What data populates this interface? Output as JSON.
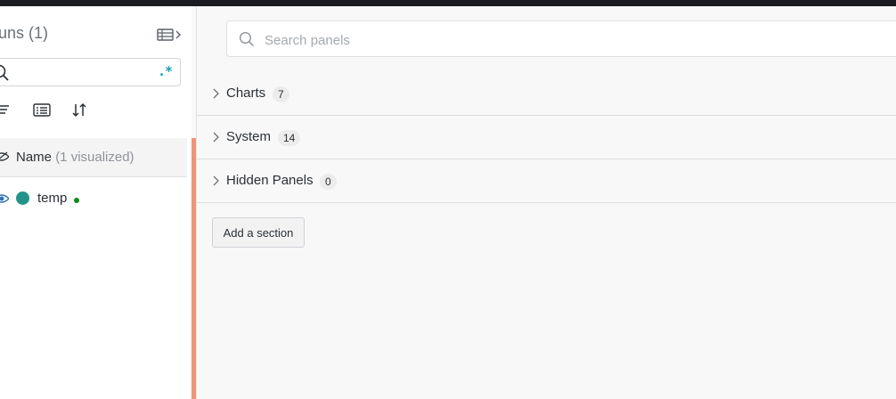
{
  "runs_panel": {
    "title": "uns (1)",
    "search": {
      "value": "",
      "placeholder": ""
    },
    "regex_label": ".*",
    "header": {
      "name_label": "Name",
      "visualized_label": "(1 visualized)"
    },
    "rows": [
      {
        "name": "temp",
        "color": "#229487",
        "status_color": "#0b8a17"
      }
    ],
    "toolbar_icons": [
      "filter-icon",
      "group-icon",
      "sort-icon"
    ]
  },
  "main": {
    "search": {
      "placeholder": "Search panels",
      "value": ""
    },
    "sections": [
      {
        "title": "Charts",
        "count": "7"
      },
      {
        "title": "System",
        "count": "14"
      },
      {
        "title": "Hidden Panels",
        "count": "0"
      }
    ],
    "add_section_label": "Add a section"
  },
  "colors": {
    "accent_divider": "#ee9577",
    "regex_teal": "#13a3b8",
    "topbar": "#1a1c1f"
  }
}
